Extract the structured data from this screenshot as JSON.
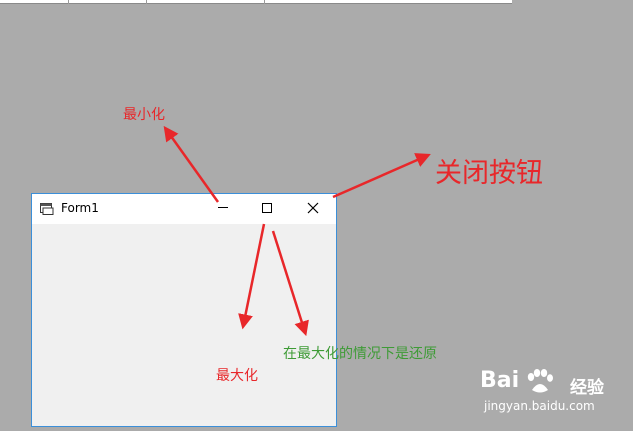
{
  "window": {
    "title": "Form1"
  },
  "annotations": {
    "minimize": "最小化",
    "close": "关闭按钮",
    "maximize": "最大化",
    "restore": "在最大化的情况下是还原"
  },
  "colors": {
    "background": "#ababab",
    "annotation_red": "#e8272a",
    "annotation_green": "#3e9b36",
    "window_border": "#3b8fd9",
    "client_area": "#f0f0f0"
  },
  "watermark": {
    "brand_left": "Bai",
    "brand_right": "百",
    "label": "经验",
    "url": "jingyan.baidu.com"
  }
}
